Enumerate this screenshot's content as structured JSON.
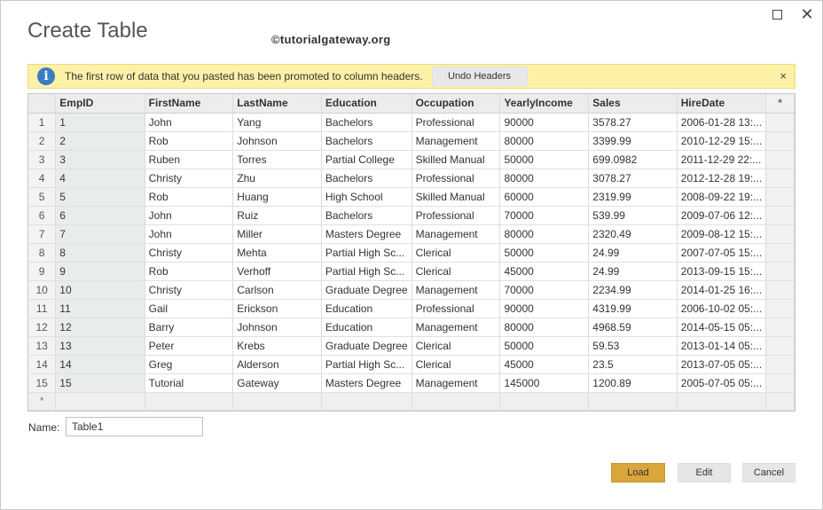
{
  "dialog": {
    "title": "Create Table",
    "watermark": "©tutorialgateway.org",
    "maximize_icon": "maximize-icon",
    "close_icon": "close-icon"
  },
  "infobar": {
    "icon": "info-icon",
    "icon_glyph": "i",
    "message": "The first row of data that you pasted has been promoted to column headers.",
    "undo_label": "Undo Headers",
    "close_glyph": "×"
  },
  "grid": {
    "columns": [
      "EmpID",
      "FirstName",
      "LastName",
      "Education",
      "Occupation",
      "YearlyIncome",
      "Sales",
      "HireDate",
      "*"
    ],
    "rows": [
      [
        "1",
        "John",
        "Yang",
        "Bachelors",
        "Professional",
        "90000",
        "3578.27",
        "2006-01-28 13:..."
      ],
      [
        "2",
        "Rob",
        "Johnson",
        "Bachelors",
        "Management",
        "80000",
        "3399.99",
        "2010-12-29 15:..."
      ],
      [
        "3",
        "Ruben",
        "Torres",
        "Partial College",
        "Skilled Manual",
        "50000",
        "699.0982",
        "2011-12-29 22:..."
      ],
      [
        "4",
        "Christy",
        "Zhu",
        "Bachelors",
        "Professional",
        "80000",
        "3078.27",
        "2012-12-28 19:..."
      ],
      [
        "5",
        "Rob",
        "Huang",
        "High School",
        "Skilled Manual",
        "60000",
        "2319.99",
        "2008-09-22 19:..."
      ],
      [
        "6",
        "John",
        "Ruiz",
        "Bachelors",
        "Professional",
        "70000",
        "539.99",
        "2009-07-06 12:..."
      ],
      [
        "7",
        "John",
        "Miller",
        "Masters Degree",
        "Management",
        "80000",
        "2320.49",
        "2009-08-12 15:..."
      ],
      [
        "8",
        "Christy",
        "Mehta",
        "Partial High Sc...",
        "Clerical",
        "50000",
        "24.99",
        "2007-07-05 15:..."
      ],
      [
        "9",
        "Rob",
        "Verhoff",
        "Partial High Sc...",
        "Clerical",
        "45000",
        "24.99",
        "2013-09-15 15:..."
      ],
      [
        "10",
        "Christy",
        "Carlson",
        "Graduate Degree",
        "Management",
        "70000",
        "2234.99",
        "2014-01-25 16:..."
      ],
      [
        "11",
        "Gail",
        "Erickson",
        "Education",
        "Professional",
        "90000",
        "4319.99",
        "2006-10-02 05:..."
      ],
      [
        "12",
        "Barry",
        "Johnson",
        "Education",
        "Management",
        "80000",
        "4968.59",
        "2014-05-15 05:..."
      ],
      [
        "13",
        "Peter",
        "Krebs",
        "Graduate Degree",
        "Clerical",
        "50000",
        "59.53",
        "2013-01-14 05:..."
      ],
      [
        "14",
        "Greg",
        "Alderson",
        "Partial High Sc...",
        "Clerical",
        "45000",
        "23.5",
        "2013-07-05 05:..."
      ],
      [
        "15",
        "Tutorial",
        "Gateway",
        "Masters Degree",
        "Management",
        "145000",
        "1200.89",
        "2005-07-05 05:..."
      ]
    ],
    "new_row_marker": "*"
  },
  "name_field": {
    "label": "Name:",
    "value": "Table1"
  },
  "buttons": {
    "load": "Load",
    "edit": "Edit",
    "cancel": "Cancel"
  },
  "colors": {
    "infobar_bg": "#fcf1a7",
    "load_button": "#d9a63c",
    "info_icon": "#3b7dc4"
  }
}
